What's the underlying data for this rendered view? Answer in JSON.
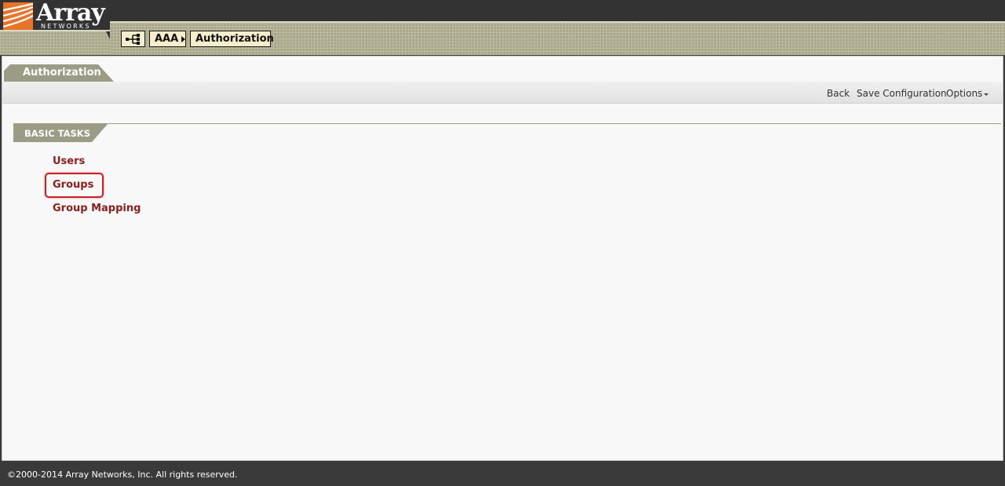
{
  "brand": {
    "name": "Array",
    "subtitle": "NETWORKS",
    "colors": {
      "accent": "#e8742a",
      "header_bg": "#333333",
      "band": "#a9a88a"
    }
  },
  "breadcrumb": {
    "home_icon": "hierarchy-icon",
    "items": [
      "AAA",
      "Authorization"
    ]
  },
  "page": {
    "title": "Authorization"
  },
  "toolbar": {
    "back_label": "Back",
    "save_label": "Save Configuration",
    "options_label": "Options"
  },
  "section": {
    "title": "BASIC TASKS",
    "tasks": [
      "Users",
      "Groups",
      "Group Mapping"
    ]
  },
  "footer": {
    "copyright": "©2000-2014 Array Networks, Inc. All rights reserved."
  }
}
